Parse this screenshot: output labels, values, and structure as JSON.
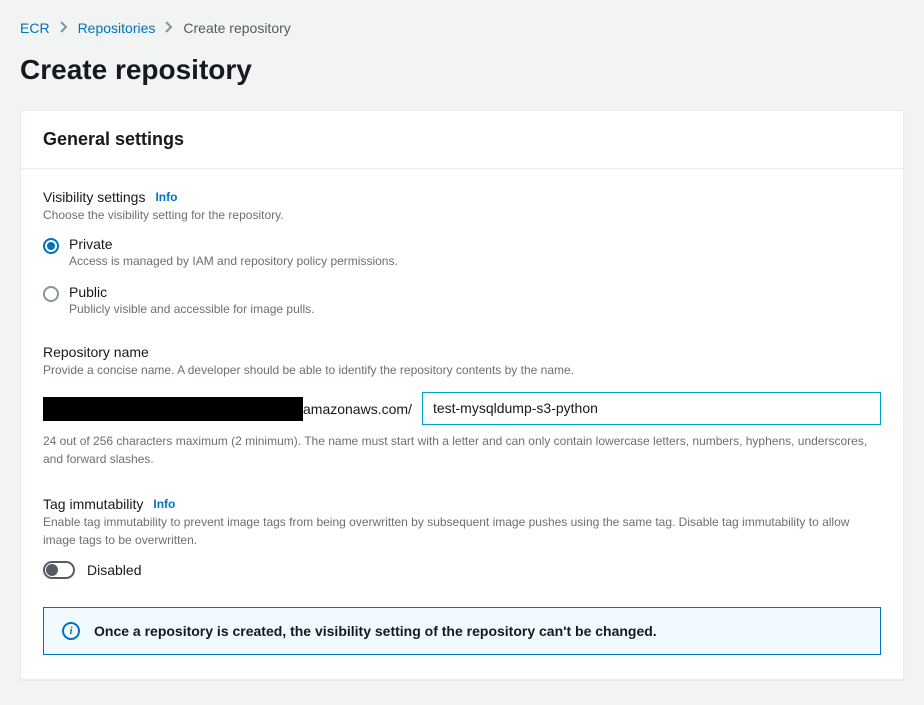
{
  "breadcrumb": {
    "items": [
      {
        "label": "ECR"
      },
      {
        "label": "Repositories"
      }
    ],
    "current": "Create repository"
  },
  "page_title": "Create repository",
  "panel": {
    "title": "General settings"
  },
  "visibility": {
    "label": "Visibility settings",
    "info": "Info",
    "help": "Choose the visibility setting for the repository.",
    "options": {
      "private": {
        "title": "Private",
        "desc": "Access is managed by IAM and repository policy permissions."
      },
      "public": {
        "title": "Public",
        "desc": "Publicly visible and accessible for image pulls."
      }
    }
  },
  "repo_name": {
    "label": "Repository name",
    "help": "Provide a concise name. A developer should be able to identify the repository contents by the name.",
    "prefix_suffix": "amazonaws.com/",
    "value": "test-mysqldump-s3-python",
    "constraint": "24 out of 256 characters maximum (2 minimum). The name must start with a letter and can only contain lowercase letters, numbers, hyphens, underscores, and forward slashes."
  },
  "tag_immutability": {
    "label": "Tag immutability",
    "info": "Info",
    "help": "Enable tag immutability to prevent image tags from being overwritten by subsequent image pushes using the same tag. Disable tag immutability to allow image tags to be overwritten.",
    "state_label": "Disabled"
  },
  "alert": {
    "text": "Once a repository is created, the visibility setting of the repository can't be changed."
  }
}
